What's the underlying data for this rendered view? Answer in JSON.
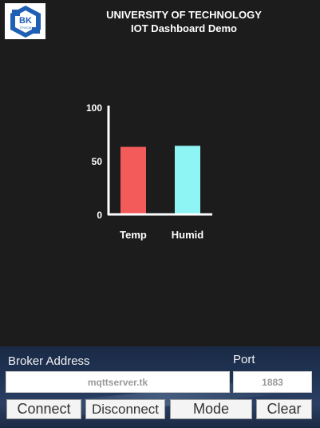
{
  "logo": {
    "text": "BK",
    "subtext": "TP.HCM"
  },
  "header": {
    "title_line1": "UNIVERSITY OF TECHNOLOGY",
    "title_line2": "IOT Dashboard Demo"
  },
  "chart_data": {
    "type": "bar",
    "categories": [
      "Temp",
      "Humid"
    ],
    "values": [
      63,
      64
    ],
    "ylim": [
      0,
      100
    ],
    "yticks": [
      0,
      50,
      100
    ],
    "colors": [
      "#f35b5b",
      "#8ef4f4"
    ],
    "axis_color": "#ffffff",
    "grid": false
  },
  "connection": {
    "broker_label": "Broker Address",
    "port_label": "Port",
    "broker_value": "mqttserver.tk",
    "port_value": "1883"
  },
  "buttons": {
    "connect": "Connect",
    "disconnect": "Disconnect",
    "mode": "Mode",
    "clear": "Clear"
  }
}
